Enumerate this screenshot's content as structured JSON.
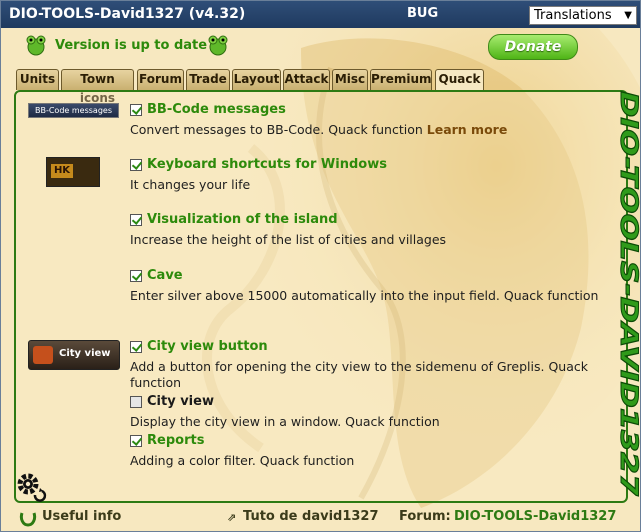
{
  "titlebar": {
    "title": "DIO-TOOLS-David1327 (v4.32)",
    "bug": "BUG",
    "translations": "Translations"
  },
  "version": {
    "text": "Version is up to date"
  },
  "donate": {
    "label": "Donate"
  },
  "tabs": [
    {
      "label": "Units"
    },
    {
      "label": "Town icons"
    },
    {
      "label": "Forum"
    },
    {
      "label": "Trade"
    },
    {
      "label": "Layout"
    },
    {
      "label": "Attack"
    },
    {
      "label": "Misc"
    },
    {
      "label": "Premium"
    },
    {
      "label": "Quack"
    }
  ],
  "options": [
    {
      "title": "BB-Code messages",
      "desc": "Convert messages to BB-Code. Quack function",
      "link": "Learn more",
      "checked": true,
      "thumb": "BB-Code messages"
    },
    {
      "title": "Keyboard shortcuts for Windows",
      "desc": "It changes your life",
      "checked": true,
      "thumb": "HK"
    },
    {
      "title": "Visualization of the island",
      "desc": "Increase the height of the list of cities and villages",
      "checked": true
    },
    {
      "title": "Cave",
      "desc": "Enter silver above 15000 automatically into the input field. Quack function",
      "checked": true
    },
    {
      "title": "City view button",
      "desc": "Add a button for opening the city view to the sidemenu of Greplis. Quack function",
      "checked": true,
      "thumb": "City view"
    },
    {
      "title": "City view",
      "desc": "Display the city view in a window. Quack function",
      "checked": false
    },
    {
      "title": "Reports",
      "desc": "Adding a color filter. Quack function",
      "checked": true
    }
  ],
  "sidebar_brand": "DIO-TOOLS-DAVID1327",
  "footer": {
    "useful": "Useful info",
    "tuto": "Tuto de david1327",
    "forum_label": "Forum:",
    "forum_value": "DIO-TOOLS-David1327"
  },
  "colors": {
    "title_bar": "#2a4a73",
    "accent_green": "#2d8a0b",
    "panel_bg": "#f8eac6"
  }
}
